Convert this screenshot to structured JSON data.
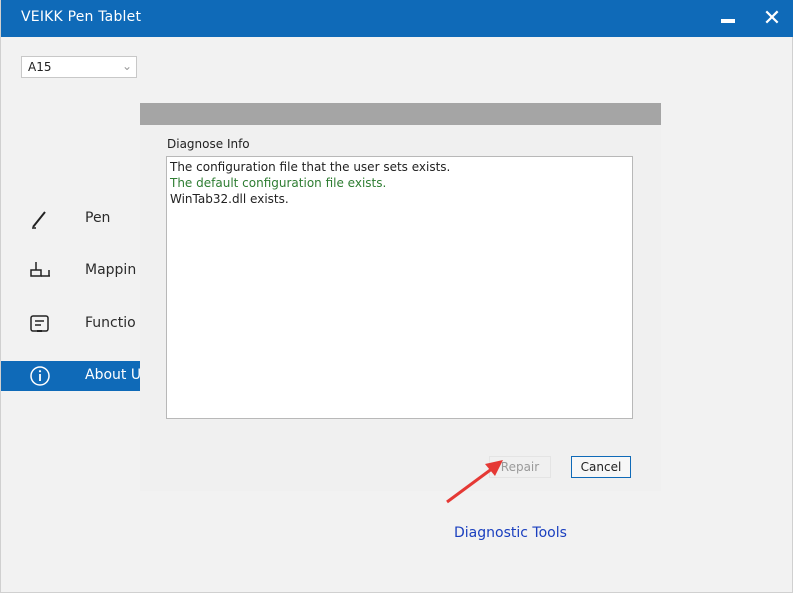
{
  "window": {
    "title": "VEIKK Pen Tablet"
  },
  "titlebar": {
    "minimize_icon": "minimize-icon",
    "close_icon": "close-icon",
    "close_glyph": "✕"
  },
  "model_select": {
    "value": "A15",
    "chevron": "⌄"
  },
  "sidebar": {
    "items": [
      {
        "label": "Pen",
        "icon": "pen-icon",
        "active": false
      },
      {
        "label": "Mappin",
        "icon": "mapping-icon",
        "active": false
      },
      {
        "label": "Functio",
        "icon": "function-keys-icon",
        "active": false
      },
      {
        "label": "About U",
        "icon": "info-icon",
        "active": true
      }
    ]
  },
  "dialog": {
    "section_label": "Diagnose Info",
    "lines": [
      "The configuration file that the user sets exists.",
      "The default configuration file exists.",
      "WinTab32.dll exists."
    ],
    "highlighted_line": 1,
    "repair_label": "Repair",
    "repair_enabled": false,
    "cancel_label": "Cancel"
  },
  "diagnostic_link": "Diagnostic Tools",
  "colors": {
    "titlebar": "#0f6ab8",
    "active_nav": "#0f6ab8",
    "dialog_header": "#a5a5a5",
    "link": "#1a3fbf",
    "annotation_arrow": "#e53935",
    "highlight_text": "#2e7d32"
  }
}
